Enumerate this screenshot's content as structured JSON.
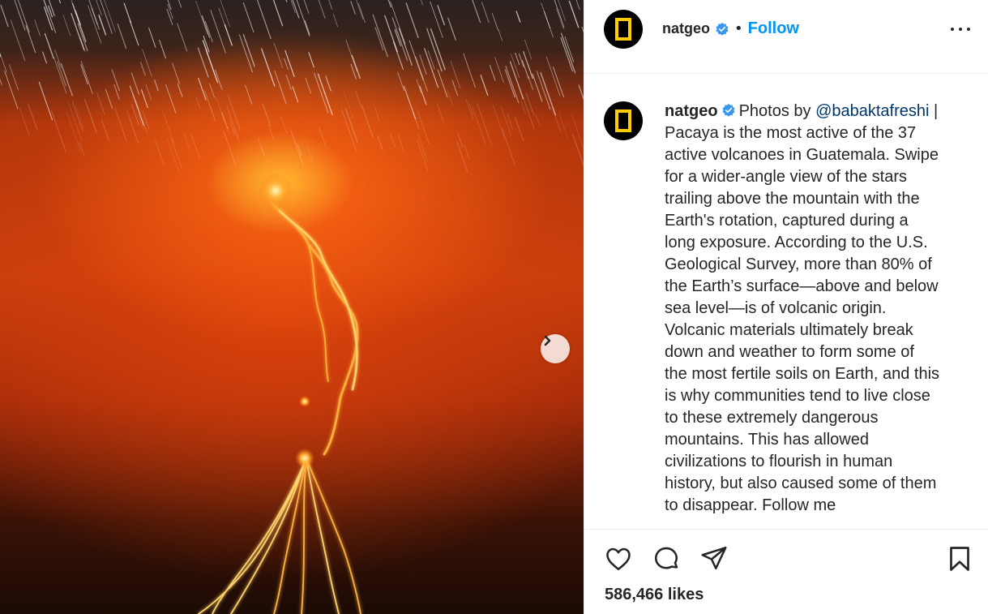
{
  "post": {
    "username": "natgeo",
    "follow_label": "Follow",
    "separator": "•",
    "caption_lines": [
      "Pacaya is the most active of the 37",
      "active volcanoes in Guatemala. Swipe",
      "for a wider-angle view of the stars",
      "trailing above the mountain with the",
      "Earth's rotation, captured during a",
      "long exposure. According to the U.S.",
      "Geological Survey, more than 80% of",
      "the Earth’s surface—above and below",
      "sea level—is of volcanic origin.",
      "Volcanic materials ultimately break",
      "down and weather to form some of",
      "the most fertile soils on Earth, and this",
      "is why communities tend to live close",
      "to these extremely dangerous",
      "mountains. This has allowed",
      "civilizations to flourish in human",
      "history, but also caused some of them",
      "to disappear. Follow me"
    ],
    "caption_prefix": "Photos by",
    "mention": "@babaktafreshi",
    "mention_suffix": " |",
    "likes": "586,466 likes"
  },
  "icons": {
    "verified": "verified-badge-icon",
    "more": "more-options-icon",
    "next": "chevron-right-icon",
    "like": "heart-icon",
    "comment": "comment-icon",
    "share": "paper-plane-icon",
    "save": "bookmark-icon"
  },
  "colors": {
    "accent": "#0095f6",
    "mention": "#00376b",
    "text": "#262626",
    "verified": "#3897f0",
    "logo_yellow": "#ffcc00"
  }
}
